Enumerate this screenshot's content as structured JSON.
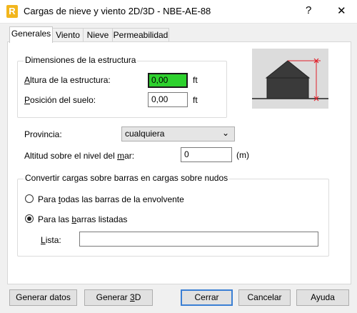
{
  "window": {
    "title": "Cargas de nieve y viento 2D/3D - NBE-AE-88",
    "help_glyph": "?",
    "close_glyph": "✕",
    "app_icon_letter": "R"
  },
  "tabs": [
    {
      "label": "Generales",
      "active": true
    },
    {
      "label": "Viento",
      "active": false
    },
    {
      "label": "Nieve",
      "active": false
    },
    {
      "label": "Permeabilidad",
      "active": false
    }
  ],
  "dimensions": {
    "group_label": "Dimensiones de la estructura",
    "height_label_pre": "",
    "height_label_u": "A",
    "height_label_post": "ltura de la estructura:",
    "height_value": "0,00",
    "height_unit": "ft",
    "floor_label_u": "P",
    "floor_label_post": "osición del suelo:",
    "floor_value": "0,00",
    "floor_unit": "ft"
  },
  "province": {
    "label": "Provincia:",
    "selected": "cualquiera"
  },
  "altitude": {
    "label_pre": "Altitud sobre el nivel del ",
    "label_u": "m",
    "label_post": "ar:",
    "value": "0",
    "unit": "(m)"
  },
  "convert": {
    "group_label": "Convertir cargas sobre barras en cargas sobre nudos",
    "option_all_pre": "Para ",
    "option_all_u": "t",
    "option_all_post": "odas las barras de la envolvente",
    "option_all_selected": false,
    "option_listed_pre": "Para las ",
    "option_listed_u": "b",
    "option_listed_post": "arras listadas",
    "option_listed_selected": true,
    "list_label_u": "L",
    "list_label_post": "ista:",
    "list_value": ""
  },
  "buttons": {
    "generate_data": "Generar datos",
    "generate_3d_pre": "Generar ",
    "generate_3d_u": "3",
    "generate_3d_post": "D",
    "close": "Cerrar",
    "cancel": "Cancelar",
    "help": "Ayuda"
  },
  "colors": {
    "highlight_field": "#2ed12e",
    "diagram_arrow": "#e0202a",
    "default_button_border": "#3b7fd4"
  }
}
